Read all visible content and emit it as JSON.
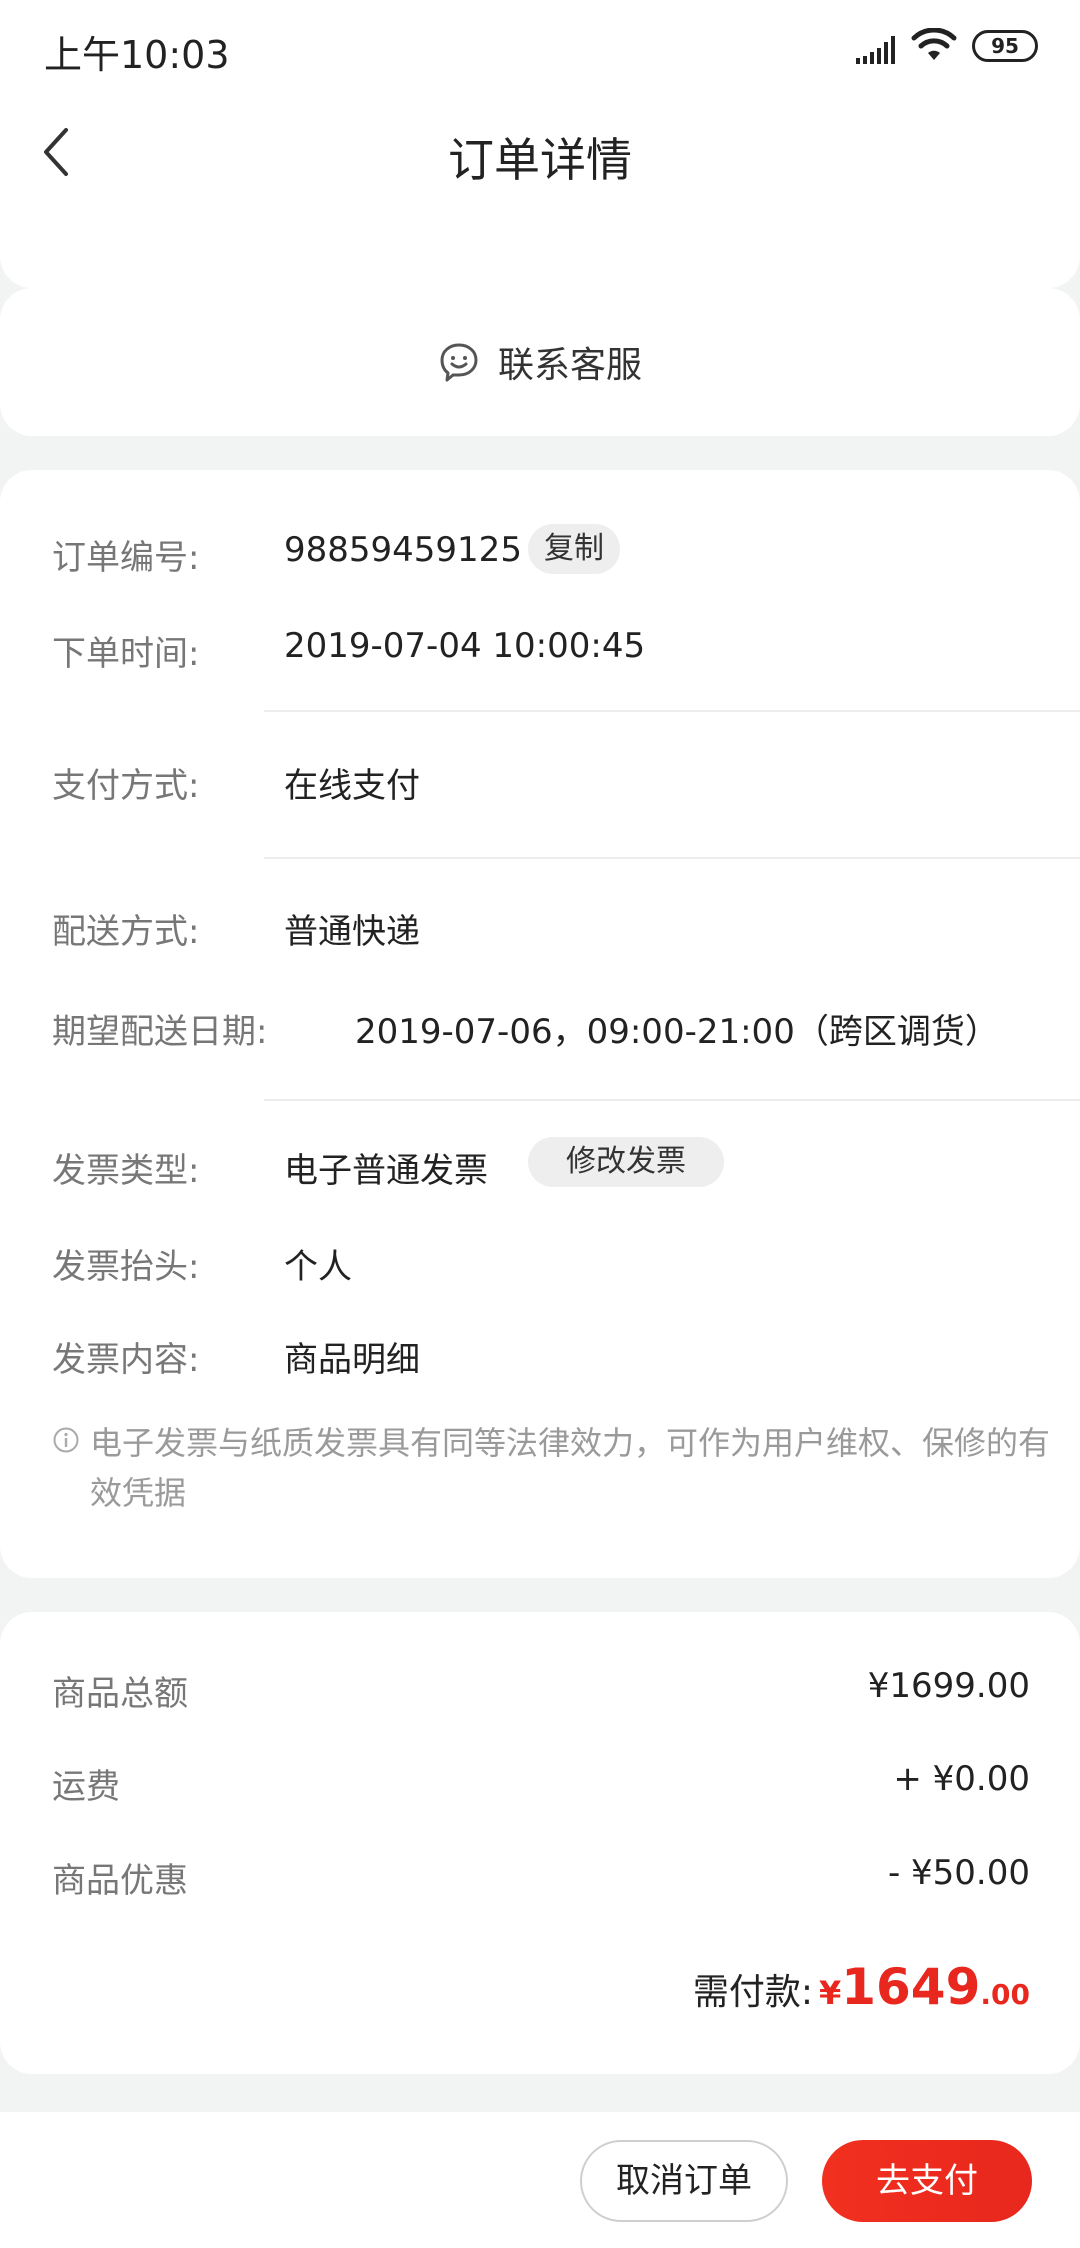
{
  "status_bar": {
    "time": "上午10:03",
    "battery": "95"
  },
  "header": {
    "title": "订单详情"
  },
  "customer_service": {
    "label": "联系客服"
  },
  "order_info": {
    "order_number": {
      "label": "订单编号:",
      "value": "98859459125",
      "action": "复制"
    },
    "order_time": {
      "label": "下单时间:",
      "value": "2019-07-04 10:00:45"
    },
    "payment_method": {
      "label": "支付方式:",
      "value": "在线支付"
    },
    "delivery_method": {
      "label": "配送方式:",
      "value": "普通快递"
    },
    "expected_date": {
      "label": "期望配送日期:",
      "value": "2019-07-06，09:00-21:00（跨区调货）"
    },
    "invoice_type": {
      "label": "发票类型:",
      "value": "电子普通发票",
      "action": "修改发票"
    },
    "invoice_title": {
      "label": "发票抬头:",
      "value": "个人"
    },
    "invoice_content": {
      "label": "发票内容:",
      "value": "商品明细"
    },
    "notice": "电子发票与纸质发票具有同等法律效力，可作为用户维权、保修的有效凭据"
  },
  "price_summary": {
    "subtotal": {
      "label": "商品总额",
      "amount": "¥1699.00"
    },
    "shipping": {
      "label": "运费",
      "amount": "+ ¥0.00"
    },
    "discount": {
      "label": "商品优惠",
      "amount": "- ¥50.00"
    },
    "total": {
      "label": "需付款:",
      "currency": "¥",
      "integer": "1649",
      "decimal": ".00"
    }
  },
  "actions": {
    "cancel_label": "取消订单",
    "pay_label": "去支付"
  },
  "colors": {
    "accent": "#e8271e",
    "background": "#f2f3f3"
  }
}
